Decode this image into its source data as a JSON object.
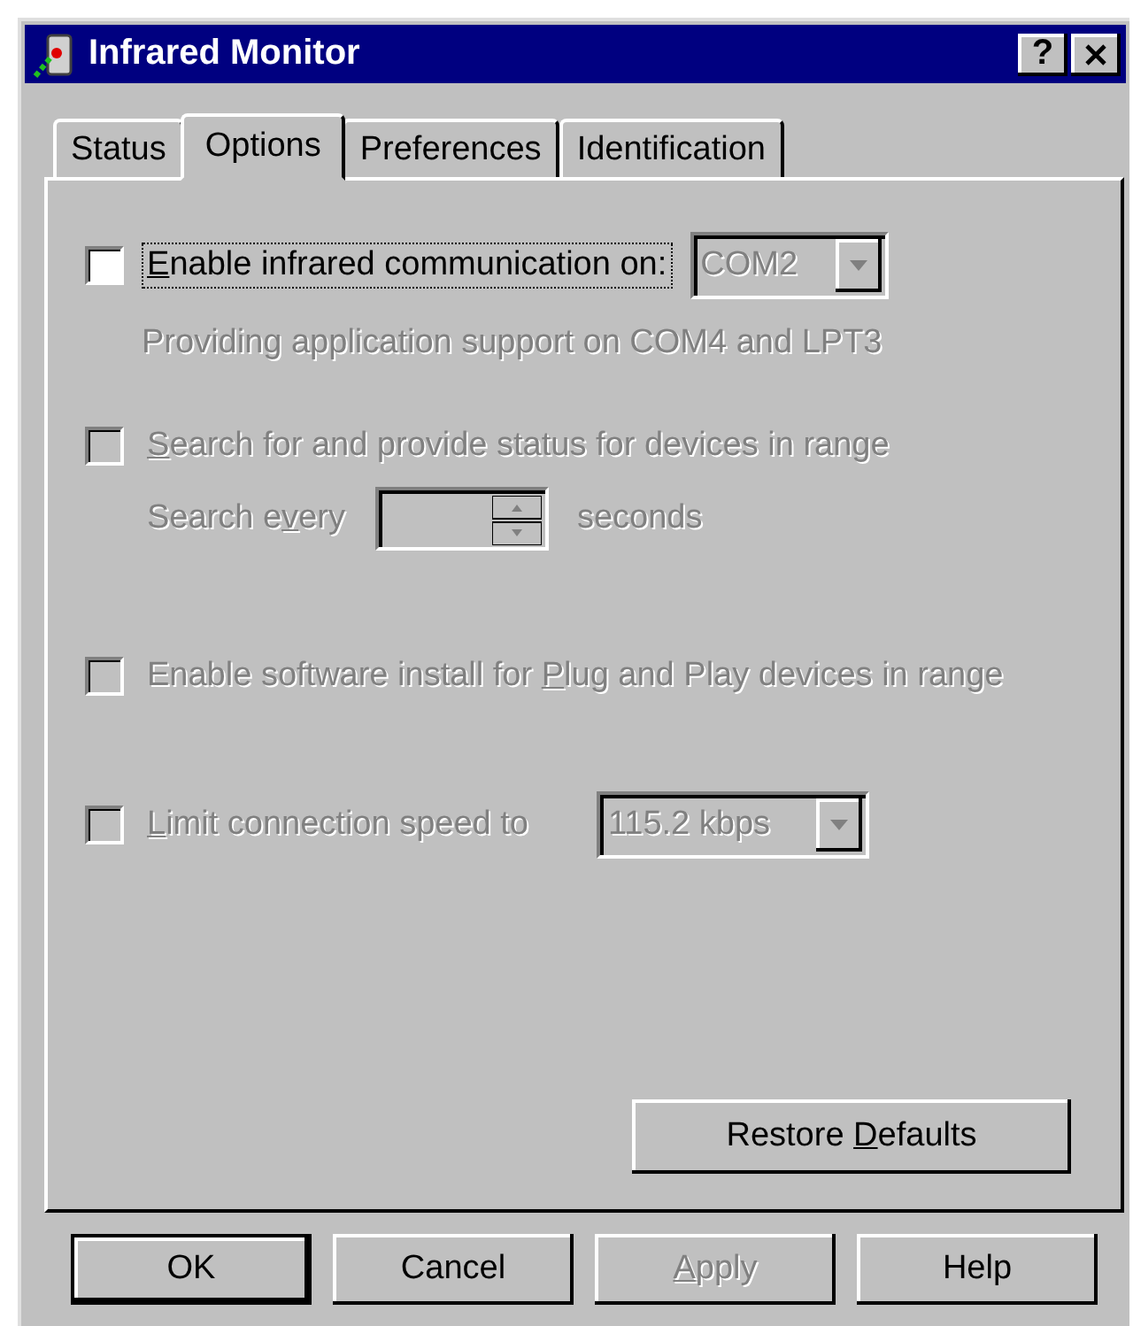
{
  "window": {
    "title": "Infrared Monitor",
    "help_button": "?"
  },
  "tabs": [
    {
      "label": "Status",
      "selected": false
    },
    {
      "label": "Options",
      "selected": true
    },
    {
      "label": "Preferences",
      "selected": false
    },
    {
      "label": "Identification",
      "selected": false
    }
  ],
  "options": [
    {
      "kind": "check-combo",
      "key": "E",
      "after": "nable infrared communication on:",
      "checked": false,
      "disabled": false,
      "focused": true,
      "combo": {
        "value": "COM2",
        "disabled": true
      }
    },
    {
      "kind": "note",
      "text": "Providing application support on COM4 and LPT3",
      "disabled": true
    },
    {
      "kind": "check",
      "key": "S",
      "after": "earch for and provide status for devices in range",
      "checked": false,
      "disabled": true,
      "focused": false
    },
    {
      "kind": "spin",
      "before": "Search e",
      "key": "v",
      "after": "ery",
      "suffix": "seconds",
      "disabled": true
    },
    {
      "kind": "check",
      "before": "Enable software install for ",
      "key": "P",
      "after": "lug and Play devices in range",
      "checked": false,
      "disabled": true,
      "focused": false
    },
    {
      "kind": "check-combo",
      "key": "L",
      "after": "imit connection speed to",
      "checked": false,
      "disabled": true,
      "focused": false,
      "combo": {
        "value": "115.2 kbps",
        "disabled": true
      }
    }
  ],
  "restore_button": {
    "before": "Restore ",
    "key": "D",
    "after": "efaults",
    "disabled": false
  },
  "buttons": [
    {
      "before": "OK",
      "default": true,
      "disabled": false
    },
    {
      "before": "Cancel",
      "default": false,
      "disabled": false
    },
    {
      "key": "A",
      "after": "pply",
      "default": false,
      "disabled": true
    },
    {
      "before": "Help",
      "default": false,
      "disabled": false
    }
  ]
}
